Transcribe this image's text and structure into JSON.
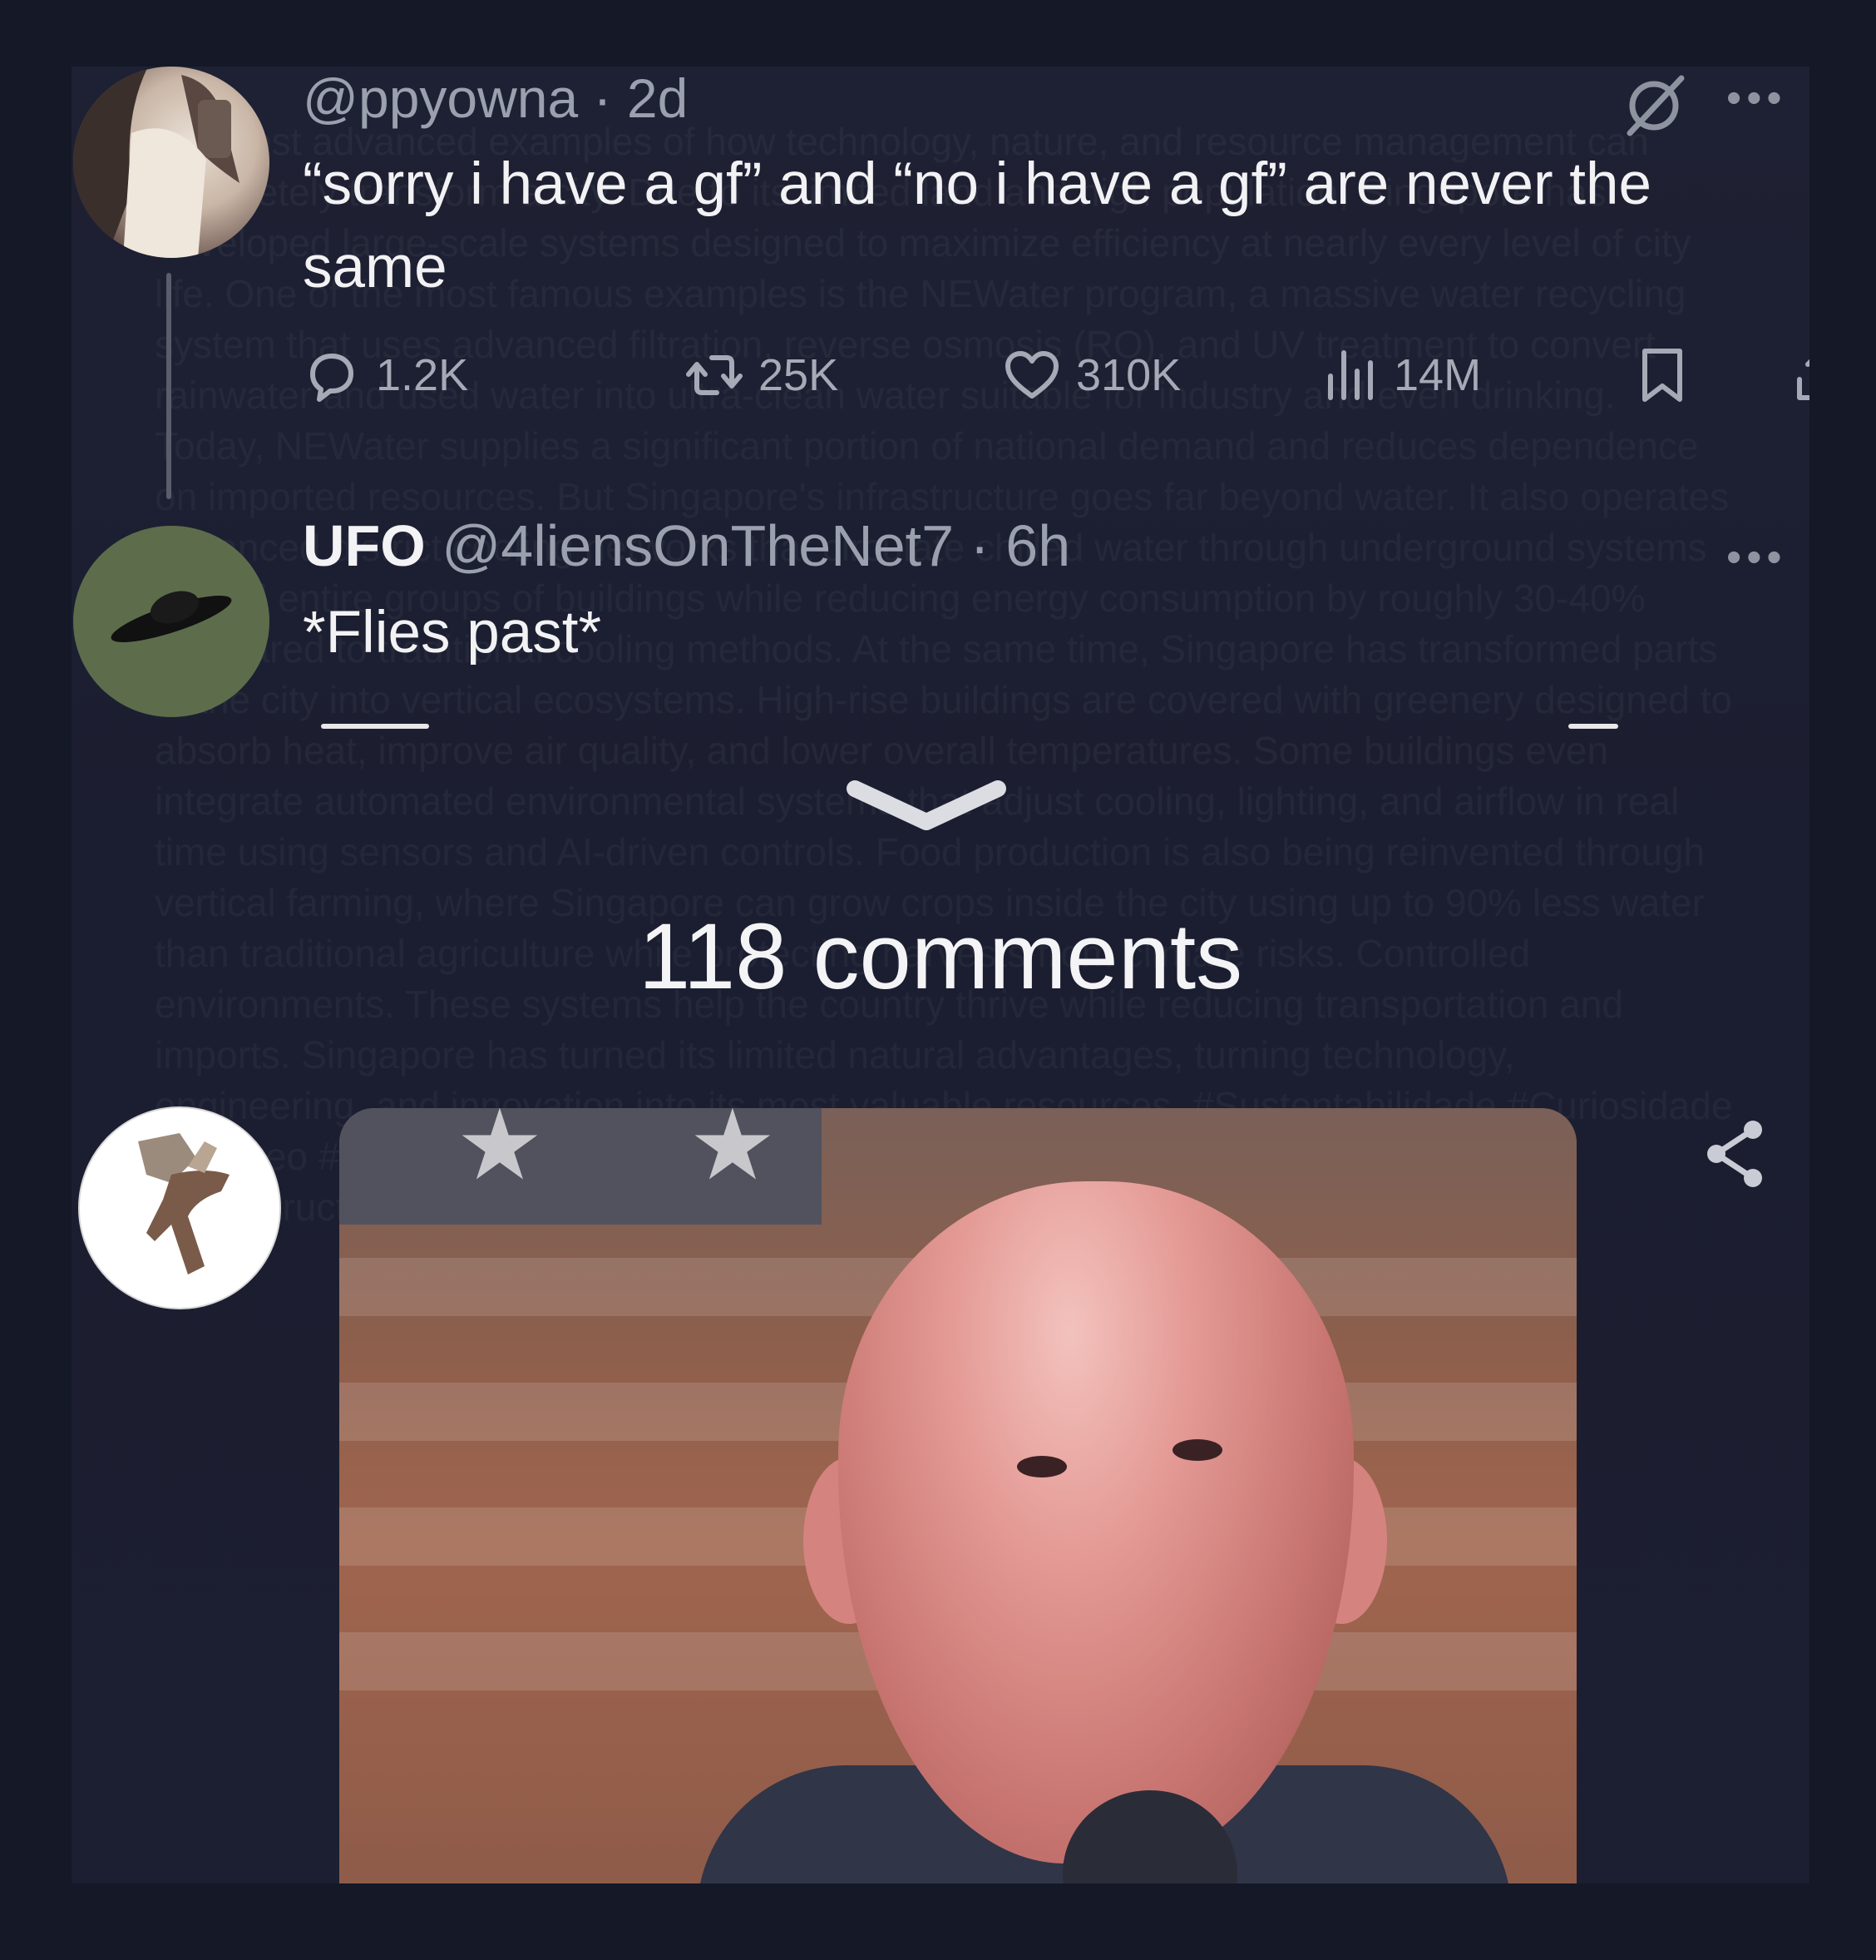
{
  "tweet": {
    "handle": "@ppyowna",
    "time": "2d",
    "text": "“sorry i have a gf” and “no i have a gf” are never the same",
    "more_icon": "ellipsis-icon",
    "grok_icon": "grok-icon",
    "actions": {
      "replies": "1.2K",
      "reposts": "25K",
      "likes": "310K",
      "views": "14M"
    }
  },
  "reply": {
    "name": "UFO",
    "handle": "@4liensOnTheNet7",
    "time": "6h",
    "text": "*Flies past*"
  },
  "comments_label": "118 comments",
  "background_text": "the most advanced examples of how technology, nature, and resource management can completely transform a city. Due to its limited land and high population, Singapore has developed large-scale systems designed to maximize efficiency at nearly every level of city life. One of the most famous examples is the NEWater program, a massive water recycling system that uses advanced filtration, reverse osmosis (RO), and UV treatment to convert rainwater and used water into ultra-clean water suitable for industry and even drinking. Today, NEWater supplies a significant portion of national demand and reduces dependence on imported resources. But Singapore's infrastructure goes far beyond water. It also operates advanced district cooling networks that circulate chilled water through underground systems to cool entire groups of buildings while reducing energy consumption by roughly 30-40% compared to traditional cooling methods. At the same time, Singapore has transformed parts of the city into vertical ecosystems. High-rise buildings are covered with greenery designed to absorb heat, improve air quality, and lower overall temperatures. Some buildings even integrate automated environmental systems that adjust cooling, lighting, and airflow in real time using sensors and AI-driven controls. Food production is also being reinvented through vertical farming, where Singapore can grow crops inside the city using up to 90% less water than traditional agriculture while protecting harvests from climate risks. Controlled environments. These systems help the country thrive while reducing transportation and imports. Singapore has turned its limited natural advantages, turning technology, engineering, and innovation into its most valuable resources. #Sustentabilidade #Curiosidade #NatGeo #Geography #InfrastructureMatters #InnovationInSweden #SolarStorage #Infrastructure #FutureCity #Innovation #InnovationNews"
}
